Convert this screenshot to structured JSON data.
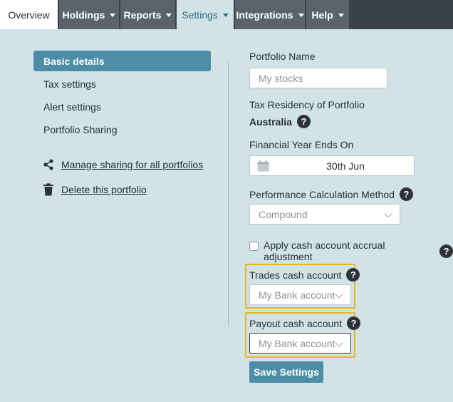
{
  "nav": {
    "tabs": [
      {
        "label": "Overview",
        "has_caret": false
      },
      {
        "label": "Holdings",
        "has_caret": true
      },
      {
        "label": "Reports",
        "has_caret": true
      },
      {
        "label": "Settings",
        "has_caret": true,
        "active": true
      },
      {
        "label": "Integrations",
        "has_caret": true
      },
      {
        "label": "Help",
        "has_caret": true
      }
    ]
  },
  "sidebar": {
    "items": [
      {
        "label": "Basic details",
        "active": true
      },
      {
        "label": "Tax settings"
      },
      {
        "label": "Alert settings"
      },
      {
        "label": "Portfolio Sharing"
      }
    ],
    "links": [
      {
        "label": "Manage sharing for all portfolios",
        "icon": "share-icon"
      },
      {
        "label": "Delete this portfolio",
        "icon": "trash-icon"
      }
    ]
  },
  "form": {
    "portfolio_name": {
      "label": "Portfolio Name",
      "placeholder": "My stocks"
    },
    "tax_residency": {
      "label": "Tax Residency of Portfolio",
      "value": "Australia"
    },
    "financial_year": {
      "label": "Financial Year Ends On",
      "value": "30th Jun"
    },
    "performance_method": {
      "label": "Performance Calculation Method",
      "value": "Compound"
    },
    "cash_accrual": {
      "label": "Apply cash account accrual adjustment",
      "checked": false
    },
    "trades_cash_account": {
      "label": "Trades cash account",
      "value": "My Bank account"
    },
    "payout_cash_account": {
      "label": "Payout cash account",
      "value": "My Bank account"
    },
    "save_label": "Save Settings",
    "help_glyph": "?"
  },
  "colors": {
    "background": "#d2e3e8",
    "nav_bg": "#3a4148",
    "accent": "#4d8ea6",
    "highlight": "#e8b422"
  }
}
